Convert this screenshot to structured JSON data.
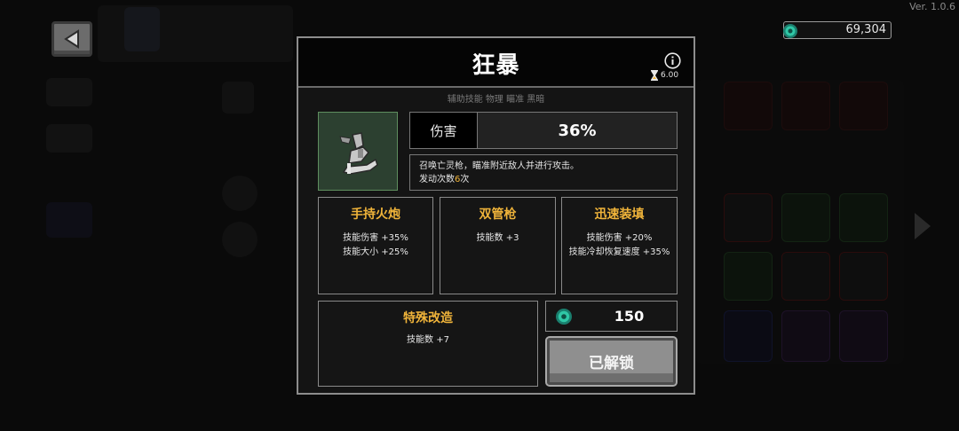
{
  "version": "Ver. 1.0.6",
  "currency": {
    "icon": "green-gem-icon",
    "amount": "69,304"
  },
  "dialog": {
    "title": "狂暴",
    "tags": "辅助技能 物理 瞄准 黑暗",
    "cooldown": {
      "icon": "hourglass-icon",
      "value": "6.00"
    },
    "info_icon": "info-icon",
    "skill_icon": "summoned-gun-icon",
    "damage": {
      "label": "伤害",
      "value": "36%"
    },
    "description": {
      "line1": "召唤亡灵枪，瞄准附近敌人并进行攻击。",
      "line2_prefix": "发动次数",
      "line2_number": "6",
      "line2_suffix": "次"
    },
    "mods": [
      {
        "title": "手持火炮",
        "lines": [
          "技能伤害 +35%",
          "技能大小 +25%"
        ]
      },
      {
        "title": "双管枪",
        "lines": [
          "技能数 +3"
        ]
      },
      {
        "title": "迅速装填",
        "lines": [
          "技能伤害 +20%",
          "技能冷却恢复速度 +35%"
        ]
      },
      {
        "title": "特殊改造",
        "lines": [
          "技能数 +7"
        ]
      }
    ],
    "cost": {
      "icon": "green-gem-icon",
      "value": "150"
    },
    "unlock_button": "已解锁"
  },
  "colors": {
    "accent": "#f0b43a",
    "gem": "#2fc7a6",
    "icon_bg": "#2c4030"
  }
}
